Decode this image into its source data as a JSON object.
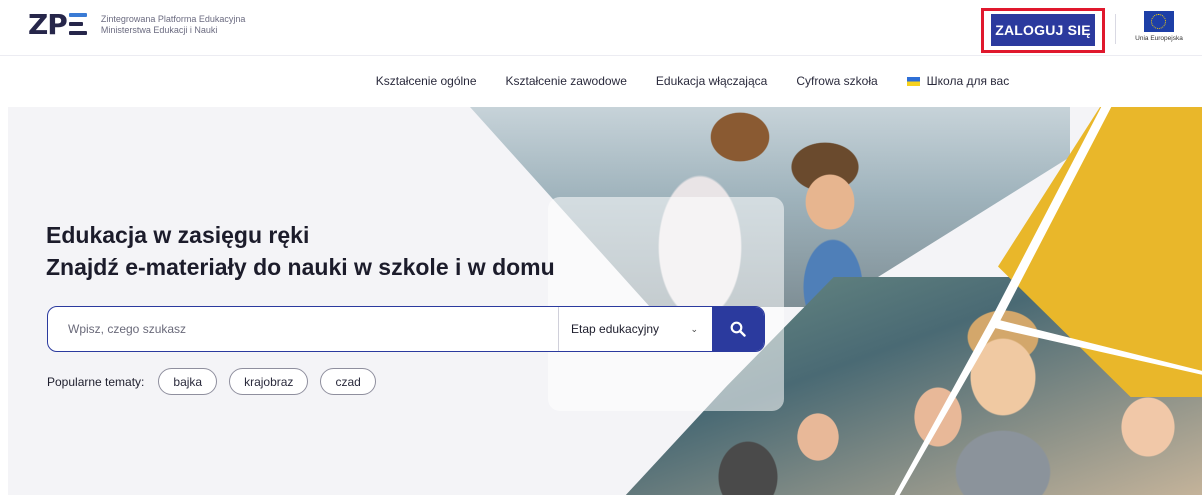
{
  "header": {
    "logo_mark": "ZP",
    "logo_line1": "Zintegrowana Platforma Edukacyjna",
    "logo_line2": "Ministerstwa Edukacji i Nauki",
    "login_label": "ZALOGUJ SIĘ",
    "eu_label": "Unia Europejska"
  },
  "nav": {
    "items": [
      {
        "label": "Kształcenie ogólne"
      },
      {
        "label": "Kształcenie zawodowe"
      },
      {
        "label": "Edukacja włączająca"
      },
      {
        "label": "Cyfrowa szkoła"
      },
      {
        "label": "Школа для вас",
        "icon": "ukraine-flag-icon"
      }
    ]
  },
  "hero": {
    "title_line1": "Edukacja w zasięgu ręki",
    "title_line2": "Znajdź e-materiały do nauki w szkole i w domu",
    "search_placeholder": "Wpisz, czego szukasz",
    "stage_select": "Etap edukacyjny",
    "popular_label": "Popularne tematy:",
    "topics": [
      "bajka",
      "krajobraz",
      "czad"
    ]
  },
  "colors": {
    "primary": "#2b3a9e",
    "highlight": "#e0182d",
    "yellow": "#e9b72a"
  }
}
